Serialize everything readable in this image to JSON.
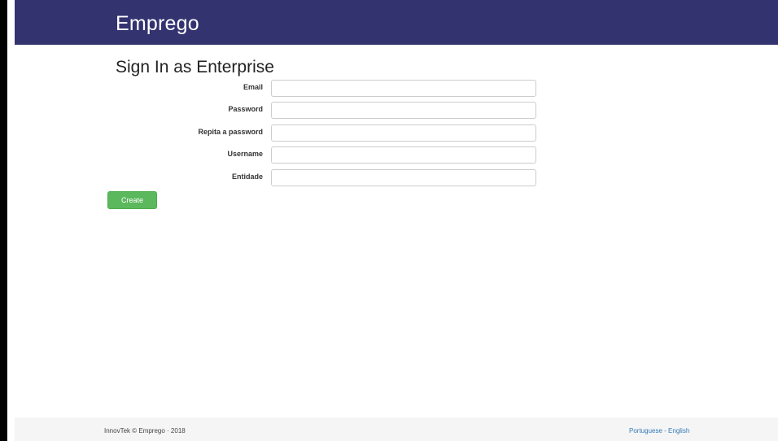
{
  "navbar": {
    "brand": "Emprego"
  },
  "page": {
    "title": "Sign In as Enterprise"
  },
  "form": {
    "fields": [
      {
        "label": "Email",
        "value": "",
        "placeholder": ""
      },
      {
        "label": "Password",
        "value": "",
        "placeholder": ""
      },
      {
        "label": "Repita a password",
        "value": "",
        "placeholder": ""
      },
      {
        "label": "Username",
        "value": "",
        "placeholder": ""
      },
      {
        "label": "Entidade",
        "value": "",
        "placeholder": ""
      }
    ],
    "submit_label": "Create"
  },
  "footer": {
    "copyright": "InnovTek © Emprego · 2018",
    "languages": [
      "Portuguese",
      "English"
    ],
    "separator": " - "
  },
  "colors": {
    "navbar_bg": "#333370",
    "button_bg": "#5cb85c",
    "link": "#337ab7",
    "footer_bg": "#f5f5f5"
  }
}
